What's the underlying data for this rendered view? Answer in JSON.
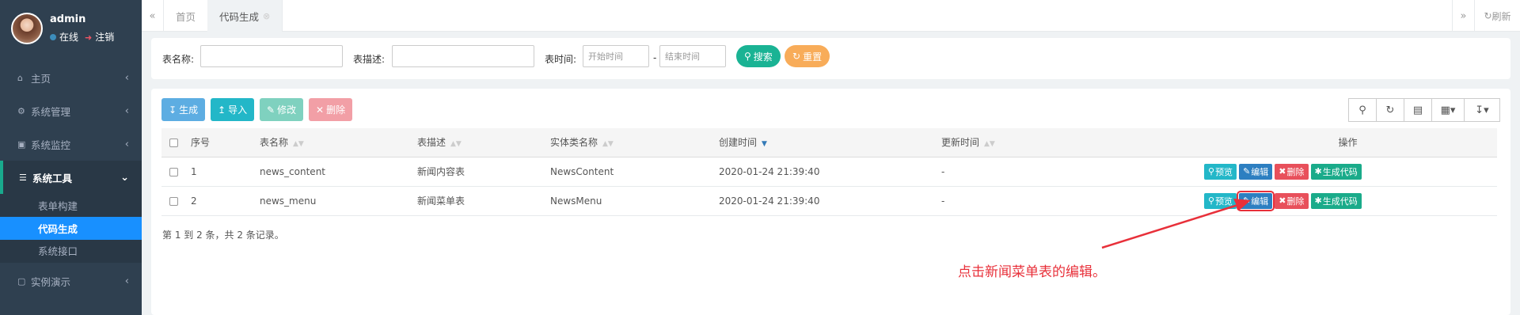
{
  "sidebar": {
    "user": {
      "name": "admin",
      "online": "在线",
      "logout": "注销"
    },
    "menu": [
      {
        "label": "主页",
        "icon": "home-icon"
      },
      {
        "label": "系统管理",
        "icon": "gear-icon"
      },
      {
        "label": "系统监控",
        "icon": "video-icon"
      },
      {
        "label": "系统工具",
        "icon": "bars-icon"
      }
    ],
    "submenu": [
      "表单构建",
      "代码生成",
      "系统接口"
    ],
    "menu_last": {
      "label": "实例演示",
      "icon": "desktop-icon"
    }
  },
  "tabs": {
    "items": [
      "首页",
      "代码生成"
    ],
    "refresh": "刷新"
  },
  "search": {
    "table_name_label": "表名称:",
    "table_desc_label": "表描述:",
    "time_label": "表时间:",
    "start_placeholder": "开始时间",
    "end_placeholder": "结束时间",
    "dash": "-",
    "search_button": "搜索",
    "reset_button": "重置"
  },
  "toolbar": {
    "generate": "生成",
    "import": "导入",
    "edit": "修改",
    "delete": "删除"
  },
  "table": {
    "headers": [
      "序号",
      "表名称",
      "表描述",
      "实体类名称",
      "创建时间",
      "更新时间",
      "操作"
    ],
    "rows": [
      {
        "index": "1",
        "name": "news_content",
        "desc": "新闻内容表",
        "entity": "NewsContent",
        "created": "2020-01-24 21:39:40",
        "updated": "-"
      },
      {
        "index": "2",
        "name": "news_menu",
        "desc": "新闻菜单表",
        "entity": "NewsMenu",
        "created": "2020-01-24 21:39:40",
        "updated": "-"
      }
    ],
    "actions": {
      "preview": "预览",
      "edit": "编辑",
      "delete": "删除",
      "gen": "生成代码"
    },
    "page_info": "第 1 到 2 条，共 2 条记录。"
  },
  "annotation": "点击新闻菜单表的编辑。",
  "colors": {
    "sidebar": "#2f4050",
    "active_sub": "#1890ff",
    "search_btn": "#1ab394",
    "reset_btn": "#f8ac59",
    "annotation": "#e8303a"
  }
}
